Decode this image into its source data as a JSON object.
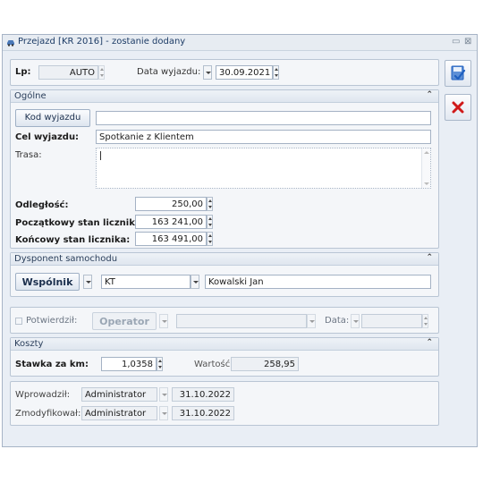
{
  "window": {
    "title": "Przejazd [KR 2016] - zostanie dodany",
    "minimize_glyph": "▭",
    "close_glyph": "⊠"
  },
  "top": {
    "lp_label": "Lp:",
    "lp_value": "AUTO",
    "data_wyjazdu_label": "Data wyjazdu:",
    "data_wyjazdu_value": "30.09.2021"
  },
  "ogolne": {
    "header": "Ogólne",
    "kod_button": "Kod wyjazdu",
    "kod_value": "",
    "cel_label": "Cel wyjazdu:",
    "cel_value": "Spotkanie z Klientem",
    "trasa_label": "Trasa:",
    "trasa_value": "",
    "odleglosc_label": "Odległość:",
    "odleglosc_value": "250,00",
    "poczatkowy_label": "Początkowy stan licznika:",
    "poczatkowy_value": "163 241,00",
    "koncowy_label": "Końcowy stan licznika:",
    "koncowy_value": "163 491,00"
  },
  "dysponent": {
    "header": "Dysponent samochodu",
    "type_button": "Wspólnik",
    "code_value": "KT",
    "name_value": "Kowalski Jan"
  },
  "potwierdzil": {
    "label": "Potwierdził:",
    "operator_button": "Operator",
    "operator_value": "",
    "data_label": "Data:",
    "data_value": ""
  },
  "koszty": {
    "header": "Koszty",
    "stawka_label": "Stawka za km:",
    "stawka_value": "1,0358",
    "wartosc_label": "Wartość:",
    "wartosc_value": "258,95"
  },
  "audit": {
    "wprowadzil_label": "Wprowadził:",
    "wprowadzil_user": "Administrator",
    "wprowadzil_date": "31.10.2022",
    "zmodyfikowal_label": "Zmodyfikował:",
    "zmodyfikowal_user": "Administrator",
    "zmodyfikowal_date": "31.10.2022"
  },
  "colors": {
    "title_text": "#1d3c66",
    "save_icon_blue": "#1f5fbf",
    "cancel_red": "#d01a1a"
  },
  "icons": {
    "title": "car-icon",
    "save": "save-icon",
    "cancel": "cancel-x-icon"
  }
}
